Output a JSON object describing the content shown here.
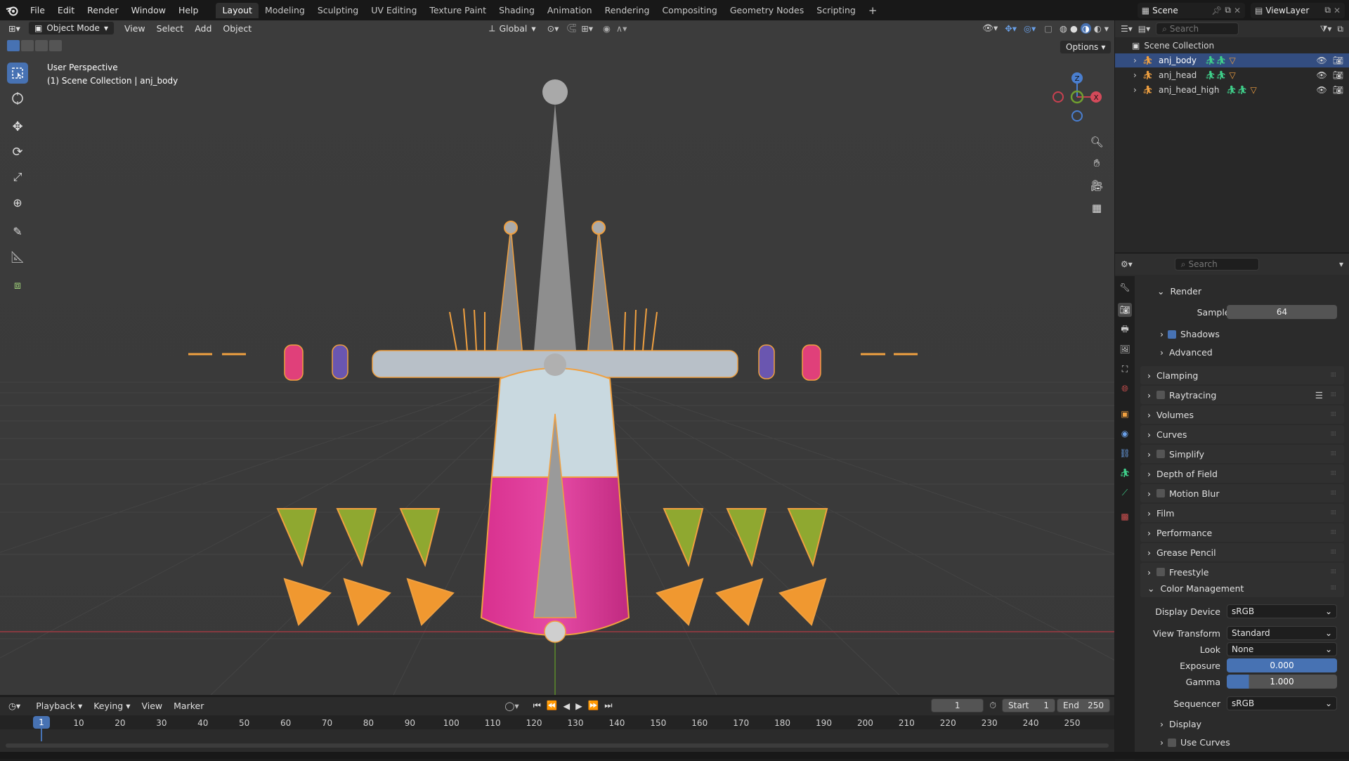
{
  "menus": [
    "File",
    "Edit",
    "Render",
    "Window",
    "Help"
  ],
  "workspaces": [
    "Layout",
    "Modeling",
    "Sculpting",
    "UV Editing",
    "Texture Paint",
    "Shading",
    "Animation",
    "Rendering",
    "Compositing",
    "Geometry Nodes",
    "Scripting"
  ],
  "scene_name": "Scene",
  "view_layer": "ViewLayer",
  "viewport": {
    "mode": "Object Mode",
    "menus": [
      "View",
      "Select",
      "Add",
      "Object"
    ],
    "orientation": "Global",
    "options_label": "Options",
    "overlay_title": "User Perspective",
    "overlay_subtitle": "(1) Scene Collection | anj_body",
    "gizmo": {
      "x": "X",
      "y": "Y",
      "z": "Z"
    }
  },
  "outliner": {
    "search_placeholder": "Search",
    "root": "Scene Collection",
    "items": [
      {
        "name": "anj_body",
        "selected": true
      },
      {
        "name": "anj_head",
        "selected": false
      },
      {
        "name": "anj_head_high",
        "selected": false
      }
    ]
  },
  "properties": {
    "search_placeholder": "Search",
    "render_panel": "Render",
    "samples_label": "Samples",
    "samples_value": "64",
    "shadows_label": "Shadows",
    "advanced_label": "Advanced",
    "panels": [
      {
        "label": "Clamping",
        "check": false
      },
      {
        "label": "Raytracing",
        "check": true
      },
      {
        "label": "Volumes",
        "check": false
      },
      {
        "label": "Curves",
        "check": false
      },
      {
        "label": "Simplify",
        "check": true
      },
      {
        "label": "Depth of Field",
        "check": false
      },
      {
        "label": "Motion Blur",
        "check": true
      },
      {
        "label": "Film",
        "check": false
      },
      {
        "label": "Performance",
        "check": false
      },
      {
        "label": "Grease Pencil",
        "check": false
      },
      {
        "label": "Freestyle",
        "check": true
      }
    ],
    "color_management": {
      "title": "Color Management",
      "display_device_label": "Display Device",
      "display_device": "sRGB",
      "view_transform_label": "View Transform",
      "view_transform": "Standard",
      "look_label": "Look",
      "look": "None",
      "exposure_label": "Exposure",
      "exposure": "0.000",
      "gamma_label": "Gamma",
      "gamma": "1.000",
      "sequencer_label": "Sequencer",
      "sequencer": "sRGB",
      "display_label": "Display",
      "use_curves_label": "Use Curves"
    }
  },
  "timeline": {
    "menus": [
      "Playback",
      "Keying",
      "View",
      "Marker"
    ],
    "current_frame": "1",
    "start_label": "Start",
    "start": "1",
    "end_label": "End",
    "end": "250",
    "ticks": [
      "1",
      "10",
      "20",
      "30",
      "40",
      "50",
      "60",
      "70",
      "80",
      "90",
      "100",
      "110",
      "120",
      "130",
      "140",
      "150",
      "160",
      "170",
      "180",
      "190",
      "200",
      "210",
      "220",
      "230",
      "240",
      "250"
    ]
  },
  "colors": {
    "accent": "#4772b3",
    "selection": "#f5a03c",
    "header_bg": "#181818",
    "viewport_bg": "#3a3a3a"
  }
}
